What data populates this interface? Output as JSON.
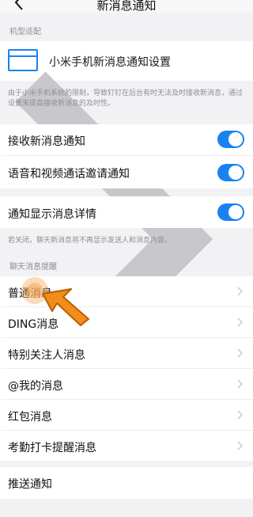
{
  "nav": {
    "title": "新消息通知"
  },
  "sections": {
    "device": "机型适配",
    "chat_reminder": "聊天消息提醒"
  },
  "device_item": {
    "label": "小米手机新消息通知设置"
  },
  "device_hint": "由于小米手机系统的限制，导致钉钉在后台有时无法及时接收新消息，通过设置来提高接收新消息的及时性。",
  "toggles": [
    {
      "label": "接收新消息通知",
      "on": true
    },
    {
      "label": "语音和视频通话邀请通知",
      "on": true
    }
  ],
  "detail_toggle": {
    "label": "通知显示消息详情",
    "on": true
  },
  "detail_hint": "若关闭，聊天新消息将不再显示发送人和消息内容。",
  "chat_items": [
    {
      "label": "普通消息"
    },
    {
      "label": "DING消息"
    },
    {
      "label": "特别关注人消息"
    },
    {
      "label": "@我的消息"
    },
    {
      "label": "红包消息"
    },
    {
      "label": "考勤打卡提醒消息"
    }
  ],
  "push_item": {
    "label": "推送通知"
  },
  "colors": {
    "accent": "#1a82f0",
    "pointer": "#f28c1a"
  }
}
